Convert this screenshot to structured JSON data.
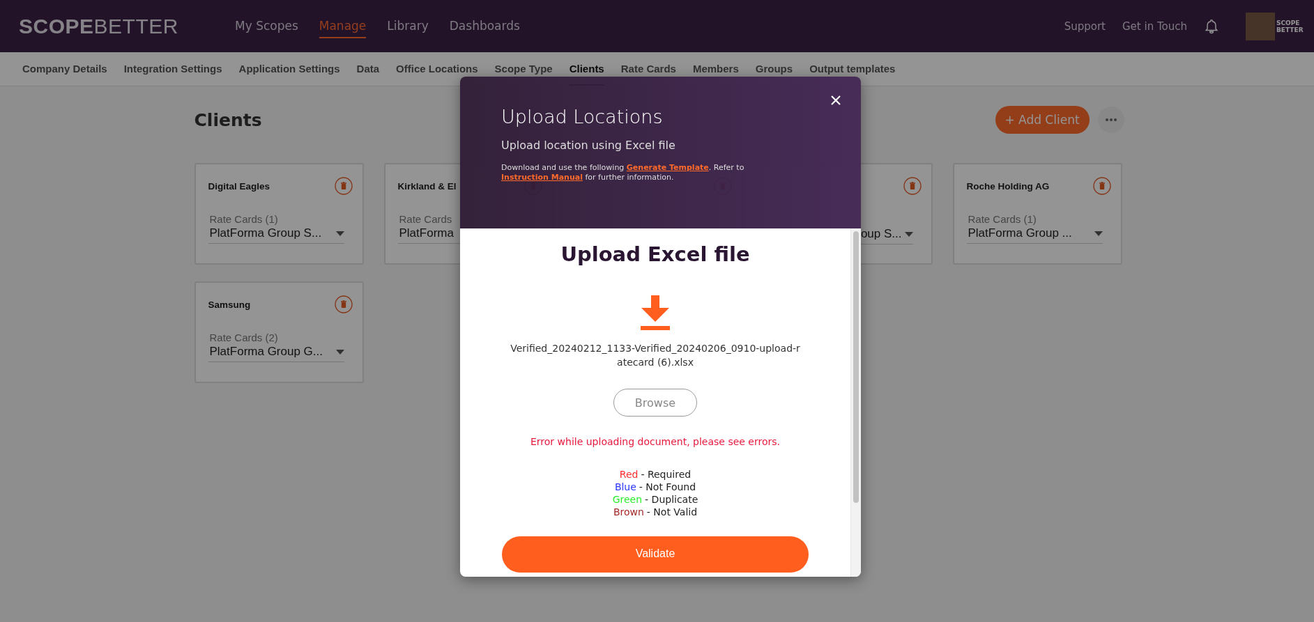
{
  "logo": {
    "part_1": "SCOPE",
    "part_2": "BETTER"
  },
  "nav": [
    {
      "label": "My Scopes",
      "selected": false
    },
    {
      "label": "Manage",
      "selected": true
    },
    {
      "label": "Library",
      "selected": false
    },
    {
      "label": "Dashboards",
      "selected": false
    }
  ],
  "header_links": [
    "Support",
    "Get in Touch"
  ],
  "avatar_logo": "SCOPE BETTER",
  "subnav": [
    {
      "label": "Company Details",
      "selected": false
    },
    {
      "label": "Integration Settings",
      "selected": false
    },
    {
      "label": "Application Settings",
      "selected": false
    },
    {
      "label": "Data",
      "selected": false
    },
    {
      "label": "Office Locations",
      "selected": false
    },
    {
      "label": "Scope Type",
      "selected": false
    },
    {
      "label": "Clients",
      "selected": true
    },
    {
      "label": "Rate Cards",
      "selected": false
    },
    {
      "label": "Members",
      "selected": false
    },
    {
      "label": "Groups",
      "selected": false
    },
    {
      "label": "Output templates",
      "selected": false
    }
  ],
  "page_title": "Clients",
  "add_button": "+ Add Client",
  "clients": [
    {
      "kind": "whole",
      "name": "Digital Eagles",
      "rate_label": "Rate Cards (1)",
      "rate_value": "PlatForma Group S..."
    },
    {
      "kind": "whole",
      "name": "Kirkland & El",
      "rate_label": "Rate Cards",
      "rate_value": "PlatForma"
    },
    {
      "kind": "covered"
    },
    {
      "kind": "right_part",
      "rate_value": "oup S..."
    },
    {
      "kind": "whole",
      "name": "Roche Holding AG",
      "rate_label": "Rate Cards (1)",
      "rate_value": "PlatForma Group ..."
    },
    {
      "kind": "whole",
      "name": "Samsung",
      "rate_label": "Rate Cards (2)",
      "rate_value": "PlatForma Group G..."
    }
  ],
  "modal": {
    "title": "Upload Locations",
    "subtitle": "Upload location using Excel file",
    "note_before": "Download and use the following",
    "link_1": "Generate Template",
    "note_middle": ". Refer to",
    "link_2": "Instruction Manual",
    "note_after": "for further information.",
    "heading": "Upload Excel file",
    "file_name": "Verified_20240212_1133-Verified_20240206_0910-upload-ratecard (6).xlsx",
    "browse_button": "Browse",
    "error": "Error while uploading document, please see errors.",
    "legend": [
      {
        "word": "Red",
        "meaning": "- Required",
        "color": "#ff2b2b"
      },
      {
        "word": "Blue",
        "meaning": "- Not Found",
        "color": "#2b35ff"
      },
      {
        "word": "Green",
        "meaning": "- Duplicate",
        "color": "#2bee2b"
      },
      {
        "word": "Brown",
        "meaning": "- Not Valid",
        "color": "#a52a2a"
      }
    ],
    "validate_button": "Validate"
  }
}
